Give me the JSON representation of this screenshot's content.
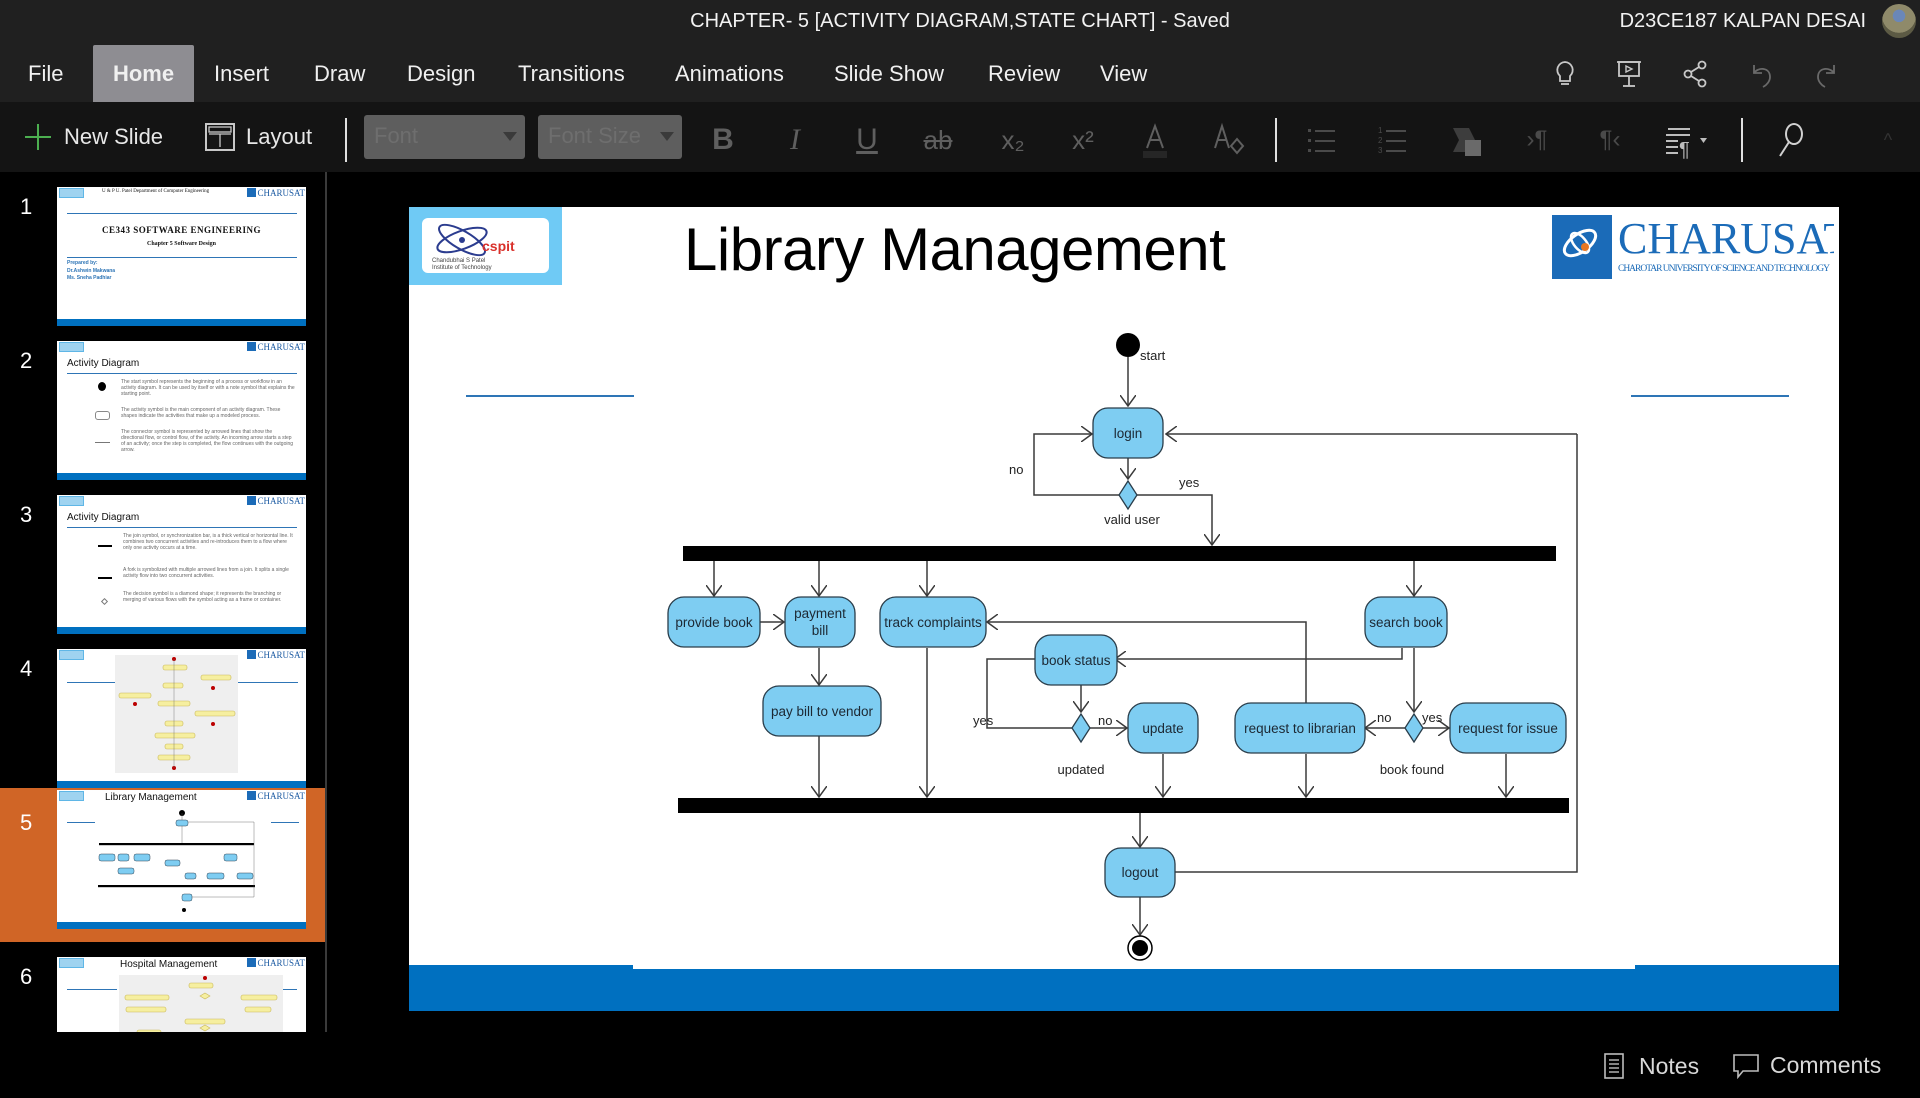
{
  "window": {
    "document_title": "CHAPTER- 5 [ACTIVITY DIAGRAM,STATE CHART] - Saved",
    "user_name": "D23CE187 KALPAN DESAI"
  },
  "menu": {
    "tabs": [
      {
        "label": "File",
        "active": false
      },
      {
        "label": "Home",
        "active": true
      },
      {
        "label": "Insert",
        "active": false
      },
      {
        "label": "Draw",
        "active": false
      },
      {
        "label": "Design",
        "active": false
      },
      {
        "label": "Transitions",
        "active": false
      },
      {
        "label": "Animations",
        "active": false
      },
      {
        "label": "Slide Show",
        "active": false
      },
      {
        "label": "Review",
        "active": false
      },
      {
        "label": "View",
        "active": false
      }
    ],
    "right_icons": [
      "lightbulb-icon",
      "present-icon",
      "share-icon",
      "undo-icon",
      "redo-icon"
    ]
  },
  "ribbon": {
    "new_slide_label": "New Slide",
    "layout_label": "Layout",
    "font_placeholder": "Font",
    "font_size_placeholder": "Font Size",
    "format_buttons": {
      "bold": "B",
      "italic": "I",
      "underline": "U",
      "strikethrough": "ab",
      "subscript": "x₂",
      "superscript": "x²"
    }
  },
  "slides_panel": {
    "active_index": 5,
    "slides": [
      {
        "number": "1",
        "header": "U & P U. Patel Department of Computer Engineering",
        "title": "CE343 SOFTWARE ENGINEERING",
        "subtitle": "Chapter 5 Software Design",
        "prepared_by": "Prepared by:",
        "authors": [
          "Dr.Ashwin Makwana",
          "Ms. Sneha Padhiar"
        ]
      },
      {
        "number": "2",
        "title": "Activity Diagram",
        "bullets": [
          "The start symbol represents the beginning of a process or workflow in an activity diagram. It can be used by itself or with a note symbol that explains the starting point.",
          "The activity symbol is the main component of an activity diagram. These shapes indicate the activities that make up a modeled process.",
          "The connector symbol is represented by arrowed lines that show the directional flow, or control flow, of the activity. An incoming arrow starts a step of an activity; once the step is completed, the flow continues with the outgoing arrow."
        ]
      },
      {
        "number": "3",
        "title": "Activity Diagram",
        "bullets": [
          "The join symbol, or synchronization bar, is a thick vertical or horizontal line. It combines two concurrent activities and re-introduces them to a flow where only one activity occurs at a time.",
          "A fork is symbolized with multiple arrowed lines from a join. It splits a single activity flow into two concurrent activities.",
          "The decision symbol is a diamond shape; it represents the branching or merging of various flows with the symbol acting as a frame or container."
        ]
      },
      {
        "number": "4",
        "title": ""
      },
      {
        "number": "5",
        "title": "Library Management"
      },
      {
        "number": "6",
        "title": "Hospital Management"
      }
    ],
    "logo_text": "CHARUSAT"
  },
  "slide": {
    "title": "Library Management",
    "left_logo": {
      "name": "cspit",
      "line1": "Chandubhai S Patel",
      "line2": "Institute of Technology"
    },
    "right_logo": {
      "name": "CHARUSAT",
      "tagline": "CHAROTAR UNIVERSITY OF SCIENCE AND TECHNOLOGY"
    },
    "colors": {
      "node_fill": "#7ecdf2",
      "bar": "#0070c0",
      "accent_line": "#2e75b6"
    },
    "diagram": {
      "start_label": "start",
      "nodes": {
        "login": "login",
        "provide_book": "provide book",
        "payment_bill_1": "payment",
        "payment_bill_2": "bill",
        "pay_bill_vendor": "pay bill to vendor",
        "track_complaints": "track complaints",
        "book_status": "book status",
        "update": "update",
        "request_librarian": "request to librarian",
        "search_book": "search book",
        "request_issue": "request for issue",
        "logout": "logout"
      },
      "decisions": {
        "valid_user": "valid user",
        "updated": "updated",
        "book_found": "book found"
      },
      "guards": {
        "valid_no": "no",
        "valid_yes": "yes",
        "updated_yes": "yes",
        "updated_no": "no",
        "found_no": "no",
        "found_yes": "yes"
      }
    }
  },
  "statusbar": {
    "notes_label": "Notes",
    "comments_label": "Comments"
  }
}
